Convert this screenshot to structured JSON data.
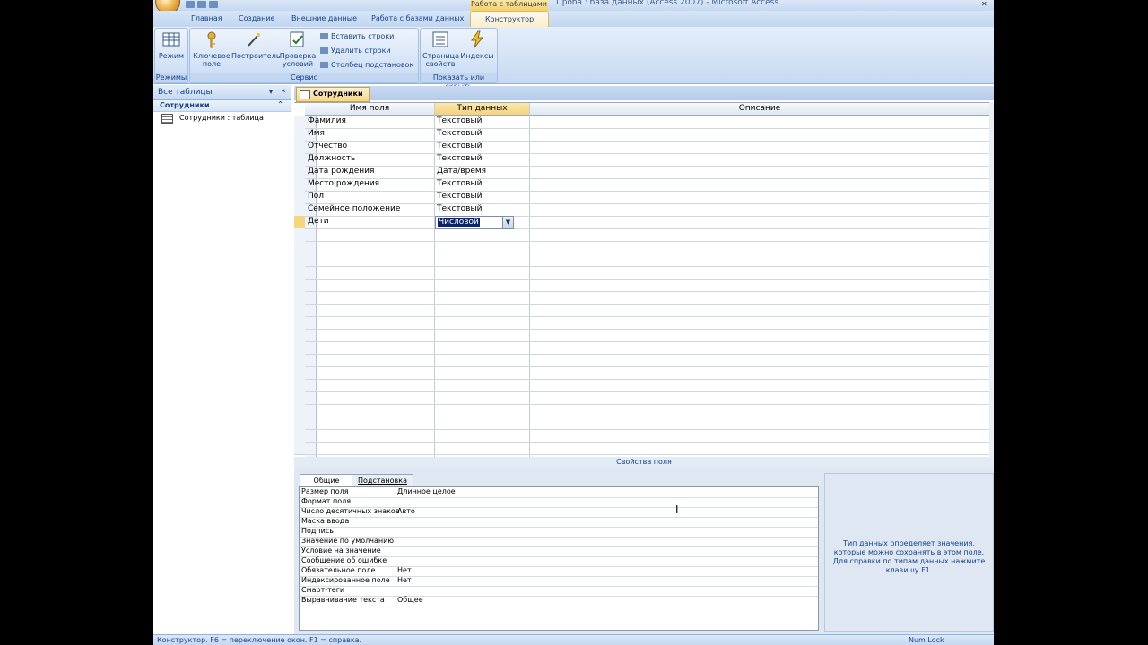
{
  "window": {
    "context_tab_label": "Работа с таблицами",
    "app_title": "Проба : база данных (Access 2007) - Microsoft Access"
  },
  "ribbon_tabs": [
    "Главная",
    "Создание",
    "Внешние данные",
    "Работа с базами данных",
    "Конструктор"
  ],
  "ribbon": {
    "groups": {
      "modes": "Режимы",
      "service": "Сервис",
      "show_hide": "Показать или скрыть"
    },
    "buttons": {
      "mode": "Режим",
      "key_field": "Ключевое поле",
      "builder": "Построитель",
      "check_conditions": "Проверка условий",
      "insert_rows": "Вставить строки",
      "delete_rows": "Удалить строки",
      "lookup_column": "Столбец подстановок",
      "property_page": "Страница свойств",
      "indexes": "Индексы"
    }
  },
  "nav_pane": {
    "header": "Все таблицы",
    "group": "Сотрудники",
    "item": "Сотрудники : таблица"
  },
  "document_tab": "Сотрудники",
  "design_grid": {
    "headers": {
      "field_name": "Имя поля",
      "data_type": "Тип данных",
      "description": "Описание"
    },
    "rows": [
      {
        "name": "Фамилия",
        "type": "Текстовый"
      },
      {
        "name": "Имя",
        "type": "Текстовый"
      },
      {
        "name": "Отчество",
        "type": "Текстовый"
      },
      {
        "name": "Должность",
        "type": "Текстовый"
      },
      {
        "name": "Дата рождения",
        "type": "Дата/время"
      },
      {
        "name": "Место рождения",
        "type": "Текстовый"
      },
      {
        "name": "Пол",
        "type": "Текстовый"
      },
      {
        "name": "Семейное положение",
        "type": "Текстовый"
      },
      {
        "name": "Дети",
        "type": "Числовой"
      }
    ]
  },
  "field_properties": {
    "label": "Свойства поля",
    "tabs": [
      "Общие",
      "Подстановка"
    ],
    "rows": [
      {
        "k": "Размер поля",
        "v": "Длинное целое"
      },
      {
        "k": "Формат поля",
        "v": ""
      },
      {
        "k": "Число десятичных знаков",
        "v": "Авто"
      },
      {
        "k": "Маска ввода",
        "v": ""
      },
      {
        "k": "Подпись",
        "v": ""
      },
      {
        "k": "Значение по умолчанию",
        "v": ""
      },
      {
        "k": "Условие на значение",
        "v": ""
      },
      {
        "k": "Сообщение об ошибке",
        "v": ""
      },
      {
        "k": "Обязательное поле",
        "v": "Нет"
      },
      {
        "k": "Индексированное поле",
        "v": "Нет"
      },
      {
        "k": "Смарт-теги",
        "v": ""
      },
      {
        "k": "Выравнивание текста",
        "v": "Общее"
      }
    ],
    "help": "Тип данных определяет значения, которые можно сохранять в этом поле. Для справки по типам данных нажмите клавишу F1."
  },
  "status_bar": {
    "left": "Конструктор. F6 = переключение окон. F1 = справка.",
    "right": "Num Lock"
  }
}
